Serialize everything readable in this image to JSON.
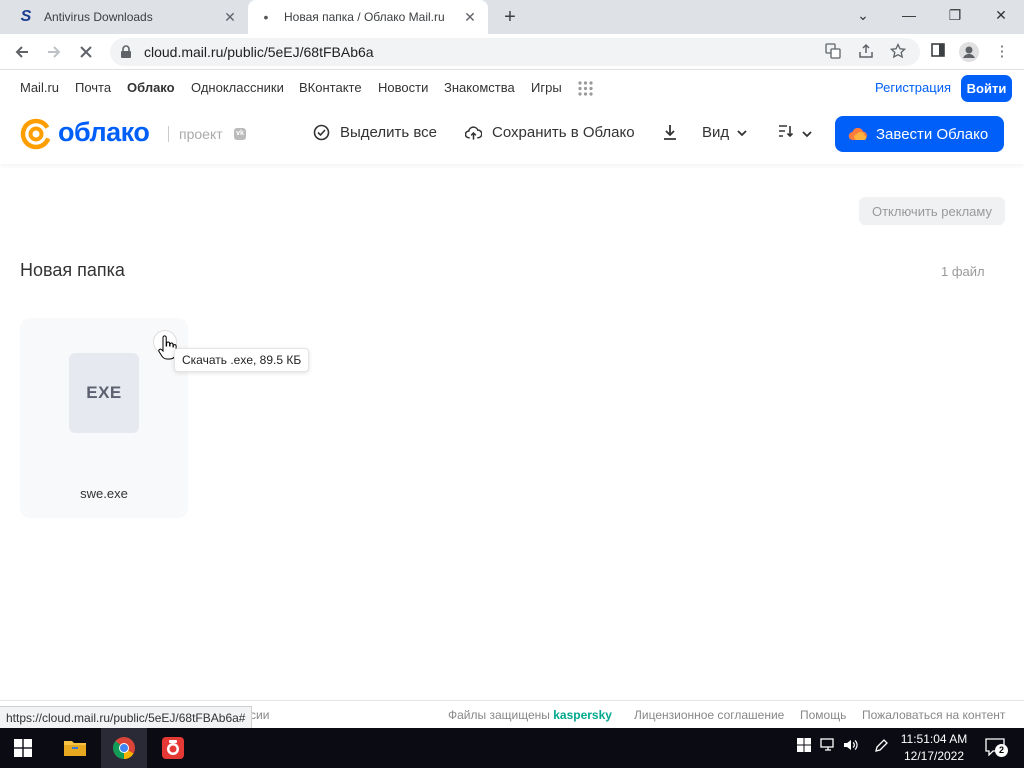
{
  "browser": {
    "tabs": [
      {
        "title": "Antivirus Downloads",
        "active": false
      },
      {
        "title": "Новая папка / Облако Mail.ru",
        "active": true
      }
    ],
    "url": "cloud.mail.ru/public/5eEJ/68tFBAb6a",
    "status_url": "https://cloud.mail.ru/public/5eEJ/68tFBAb6a#"
  },
  "portal": {
    "links": [
      "Mail.ru",
      "Почта",
      "Облако",
      "Одноклассники",
      "ВКонтакте",
      "Новости",
      "Знакомства",
      "Игры"
    ],
    "active_link": "Облако",
    "register": "Регистрация",
    "login": "Войти"
  },
  "header": {
    "logo_text": "облако",
    "project_label": "проект",
    "select_all": "Выделить все",
    "save_to_cloud": "Сохранить в Облако",
    "view": "Вид",
    "get_cloud": "Завести Облако"
  },
  "content": {
    "disable_ads": "Отключить рекламу",
    "folder_title": "Новая папка",
    "file_count": "1 файл",
    "file": {
      "name": "swe.exe",
      "type_label": "EXE",
      "download_tooltip": "Скачать .exe, 89.5 КБ"
    }
  },
  "footer": {
    "partial_link": "сии",
    "protected_by": "Файлы защищены",
    "brand": "kaspersky",
    "license": "Лицензионное соглашение",
    "help": "Помощь",
    "report": "Пожаловаться на контент"
  },
  "taskbar": {
    "time": "11:51:04 AM",
    "date": "12/17/2022",
    "notifications": "2"
  },
  "colors": {
    "accent": "#005ff9",
    "logo_orange": "#ff9e00",
    "kaspersky": "#00a88e"
  }
}
